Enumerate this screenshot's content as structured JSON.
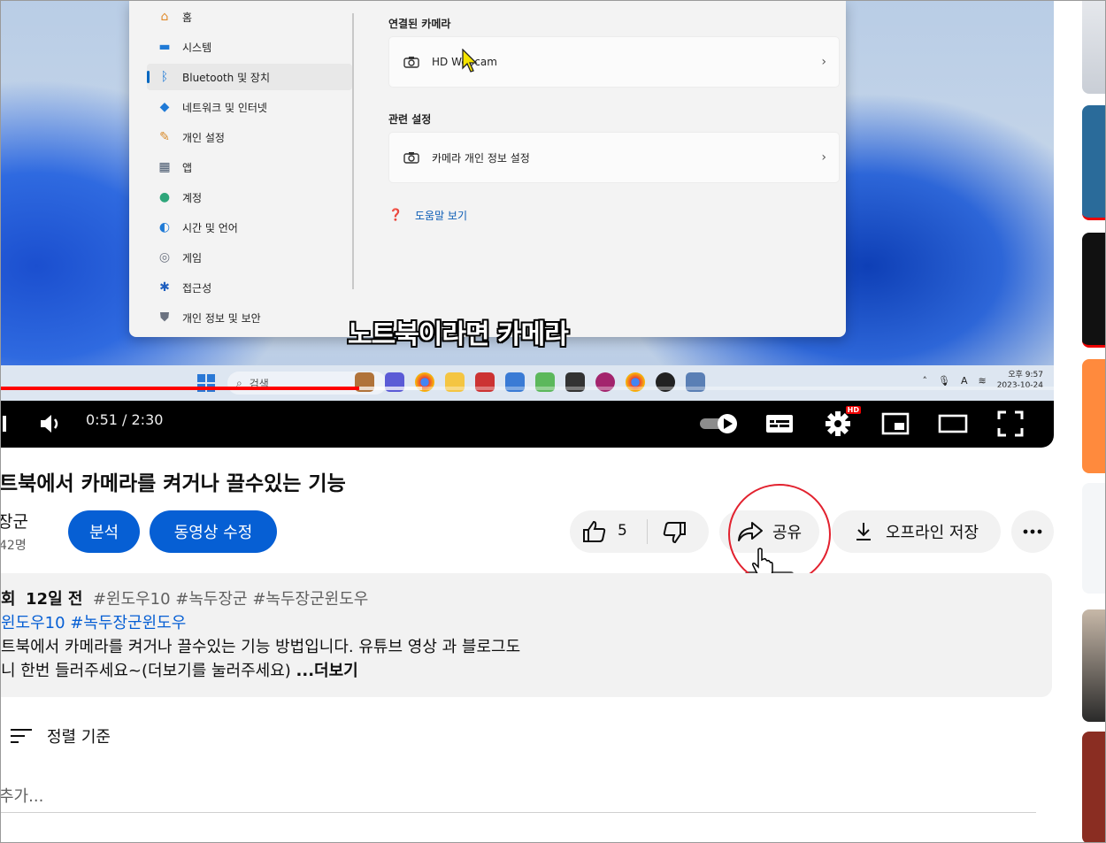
{
  "settings": {
    "sidebar": [
      {
        "label": "홈",
        "icon": "home-icon"
      },
      {
        "label": "시스템",
        "icon": "monitor-icon"
      },
      {
        "label": "Bluetooth 및 장치",
        "icon": "bluetooth-icon"
      },
      {
        "label": "네트워크 및 인터넷",
        "icon": "wifi-icon"
      },
      {
        "label": "개인 설정",
        "icon": "brush-icon"
      },
      {
        "label": "앱",
        "icon": "apps-icon"
      },
      {
        "label": "계정",
        "icon": "person-icon"
      },
      {
        "label": "시간 및 언어",
        "icon": "globe-icon"
      },
      {
        "label": "게임",
        "icon": "gamepad-icon"
      },
      {
        "label": "접근성",
        "icon": "accessibility-icon"
      },
      {
        "label": "개인 정보 및 보안",
        "icon": "shield-icon"
      }
    ],
    "connected_section": "연결된 카메라",
    "camera_item": "HD Webcam",
    "related_section": "관련 설정",
    "privacy_item": "카메라 개인 정보 설정",
    "help_link": "도움말 보기"
  },
  "video": {
    "subtitle": "노트북이라면 카메라",
    "time": "0:51 / 2:30",
    "progress": 0.34,
    "buffered": 0.4,
    "taskbar_search": "검색",
    "clock_time": "오후 9:57",
    "clock_date": "2023-10-24",
    "hd_badge": "HD"
  },
  "watch": {
    "title": "트북에서 카메라를 켜거나 끌수있는 기능",
    "channel": "장군",
    "subscribers": "42명",
    "analytics_button": "분석",
    "edit_button": "동영상 수정",
    "like_count": "5",
    "share_button": "공유",
    "download_button": "오프라인 저장",
    "tooltip": "공유"
  },
  "description": {
    "meta_views": "회",
    "meta_age": "12일 전",
    "meta_tags": "#윈도우10 #녹두장군 #녹두장군윈도우",
    "tags_line": "윈도우10 #녹두장군윈도우",
    "line1": "트북에서 카메라를 켜거나 끌수있는 기능 방법입니다. 유튜브 영상 과 블로그도",
    "line2": "니 한번 들러주세요~(더보기를 눌러주세요)",
    "more": "...더보기"
  },
  "comments": {
    "sort_label": "정렬 기준",
    "placeholder": "추가..."
  },
  "colors": {
    "accent_blue": "#065fd4",
    "progress_red": "#ff0000",
    "highlight_circle": "#e2222f"
  }
}
